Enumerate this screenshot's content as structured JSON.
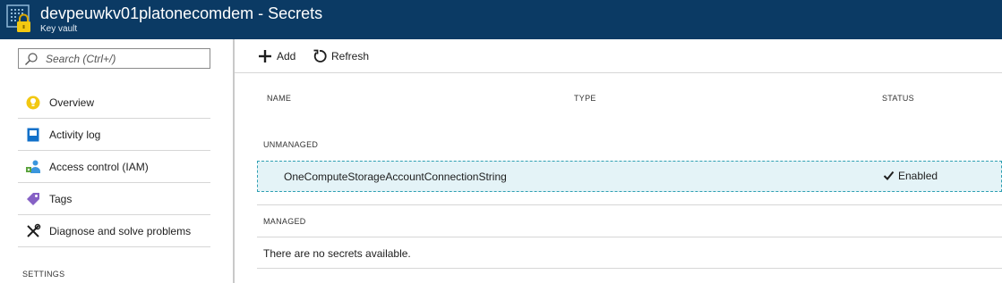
{
  "header": {
    "title": "devpeuwkv01platonecomdem - Secrets",
    "subtitle": "Key vault",
    "icon": "key-vault-icon"
  },
  "sidebar": {
    "search": {
      "placeholder": "Search (Ctrl+/)",
      "value": ""
    },
    "items": [
      {
        "label": "Overview",
        "icon": "overview-icon"
      },
      {
        "label": "Activity log",
        "icon": "activity-log-icon"
      },
      {
        "label": "Access control (IAM)",
        "icon": "access-control-icon"
      },
      {
        "label": "Tags",
        "icon": "tag-icon"
      },
      {
        "label": "Diagnose and solve problems",
        "icon": "wrench-icon"
      }
    ],
    "section_settings": "SETTINGS"
  },
  "toolbar": {
    "add_label": "Add",
    "refresh_label": "Refresh"
  },
  "table": {
    "columns": [
      "NAME",
      "TYPE",
      "STATUS"
    ],
    "groups": [
      {
        "label": "UNMANAGED",
        "rows": [
          {
            "name": "OneComputeStorageAccountConnectionString",
            "type": "",
            "status": "Enabled"
          }
        ]
      },
      {
        "label": "MANAGED",
        "empty_message": "There are no secrets available."
      }
    ]
  },
  "colors": {
    "header_bg": "#0b3a64",
    "selected_row_bg": "#e4f3f7",
    "selected_row_border": "#2fa0b3"
  }
}
